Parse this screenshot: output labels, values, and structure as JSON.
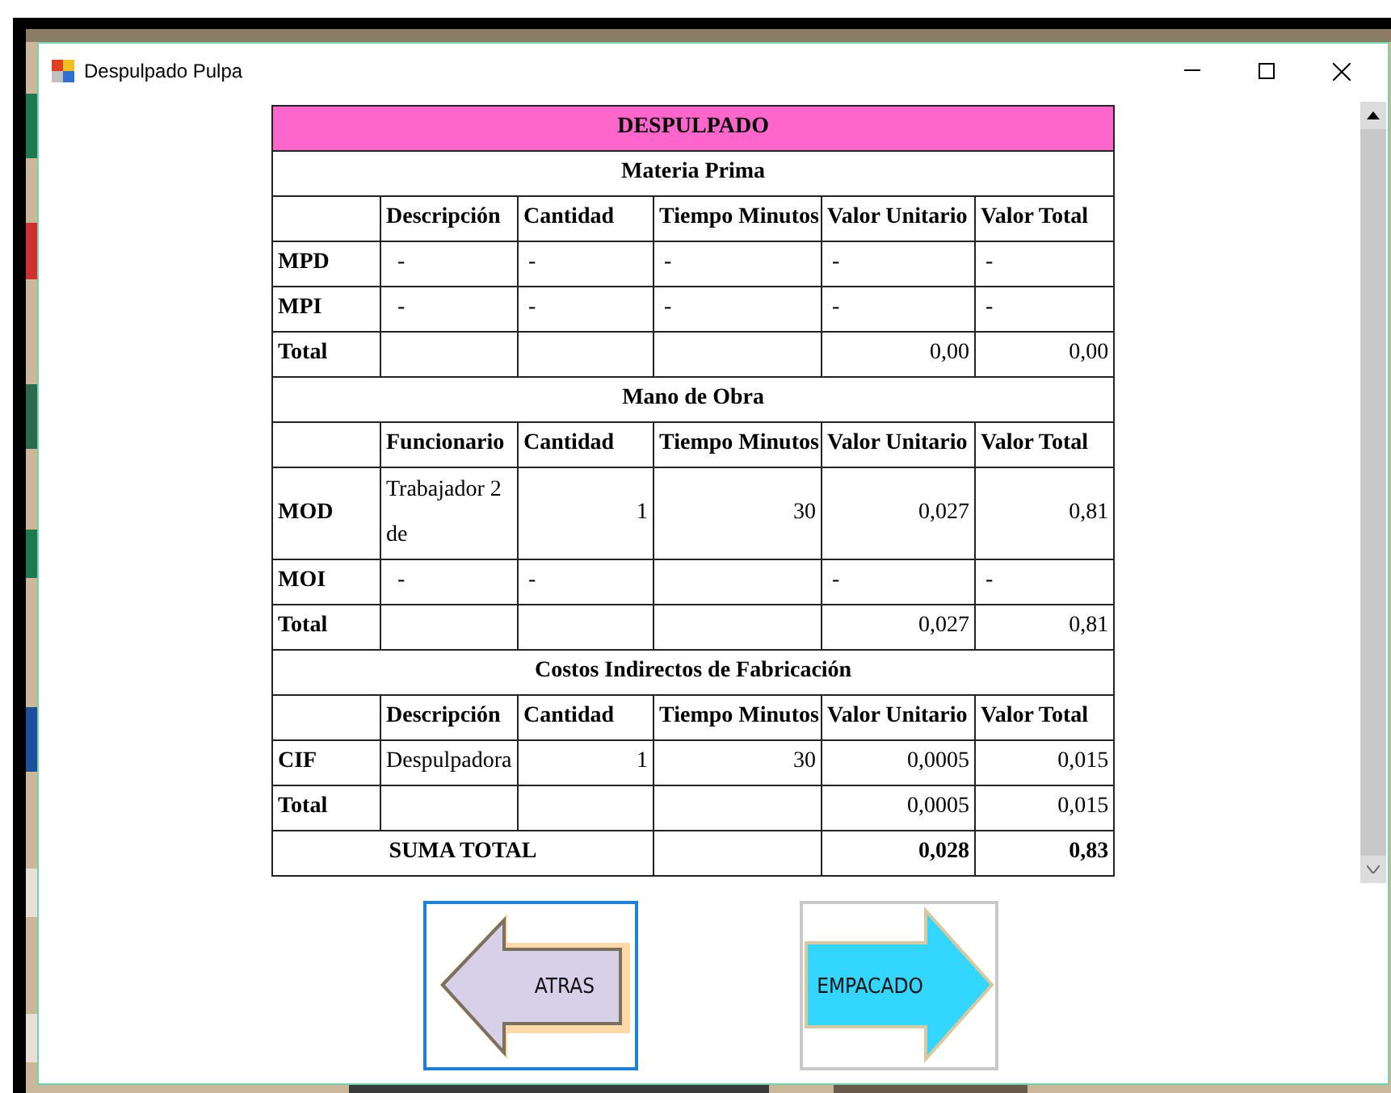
{
  "window": {
    "title": "Despulpado Pulpa"
  },
  "table": {
    "title": "DESPULPADO",
    "sections": [
      {
        "heading": "Materia Prima",
        "columns": [
          "Descripción",
          "Cantidad",
          "Tiempo Minutos",
          "Valor Unitario",
          "Valor Total"
        ],
        "rows": [
          {
            "label": "MPD",
            "cells": [
              "-",
              "-",
              "-",
              "-",
              "-"
            ]
          },
          {
            "label": "MPI",
            "cells": [
              "-",
              "-",
              "-",
              "-",
              "-"
            ]
          },
          {
            "label": "Total",
            "cells": [
              null,
              null,
              null,
              "0,00",
              "0,00"
            ]
          }
        ]
      },
      {
        "heading": "Mano de Obra",
        "columns": [
          "Funcionario",
          "Cantidad",
          "Tiempo Minutos",
          "Valor Unitario",
          "Valor Total"
        ],
        "rows": [
          {
            "label": "MOD",
            "cells": [
              "Trabajador 2 de",
              "1",
              "30",
              "0,027",
              "0,81"
            ]
          },
          {
            "label": "MOI",
            "cells": [
              "-",
              "-",
              null,
              "-",
              "-"
            ]
          },
          {
            "label": "Total",
            "cells": [
              null,
              null,
              null,
              "0,027",
              "0,81"
            ]
          }
        ]
      },
      {
        "heading": "Costos Indirectos de Fabricación",
        "columns": [
          "Descripción",
          "Cantidad",
          "Tiempo Minutos",
          "Valor Unitario",
          "Valor Total"
        ],
        "rows": [
          {
            "label": "CIF",
            "cells": [
              "Despulpadora",
              "1",
              "30",
              "0,0005",
              "0,015"
            ]
          },
          {
            "label": "Total",
            "cells": [
              null,
              null,
              null,
              "0,0005",
              "0,015"
            ]
          }
        ]
      }
    ],
    "grand_total": {
      "label": "SUMA TOTAL",
      "cells": [
        null,
        "0,028",
        "0,83"
      ]
    }
  },
  "buttons": [
    {
      "label": "ATRAS",
      "kind": "back",
      "focused": true
    },
    {
      "label": "EMPACADO",
      "kind": "next",
      "focused": false
    }
  ]
}
